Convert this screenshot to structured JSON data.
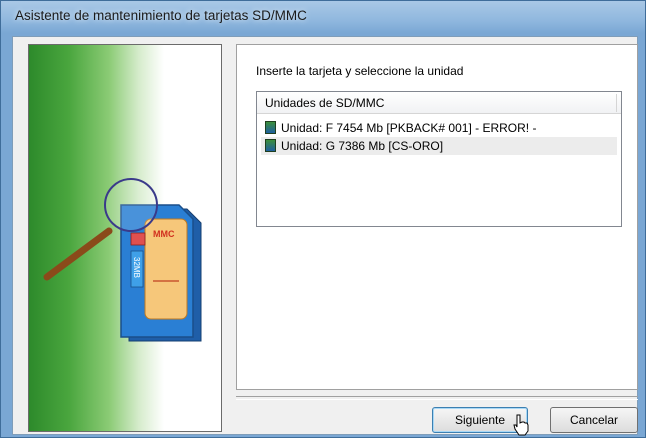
{
  "window": {
    "title": "Asistente de mantenimiento de tarjetas SD/MMC"
  },
  "main": {
    "instruction": "Inserte la tarjeta y seleccione la unidad",
    "list": {
      "header": "Unidades de SD/MMC",
      "items": [
        {
          "label": "Unidad: F 7454 Mb [PKBACK# 001]  - ERROR! -",
          "selected": false,
          "icon": "sd-card-icon"
        },
        {
          "label": "Unidad: G 7386 Mb [CS-ORO]",
          "selected": true,
          "icon": "sd-card-icon"
        }
      ]
    }
  },
  "buttons": {
    "next": "Siguiente",
    "cancel": "Cancelar"
  },
  "illustration": {
    "card_label": "MMC",
    "card_size": "32MB",
    "icons": [
      "magnifier-icon",
      "mmc-card-icon"
    ]
  },
  "colors": {
    "titlebar": "#8fb7de",
    "green_gradient": "#2d8a2b",
    "selection": "#ececec",
    "card_blue": "#2a7fd4",
    "card_orange": "#f2a33a"
  }
}
